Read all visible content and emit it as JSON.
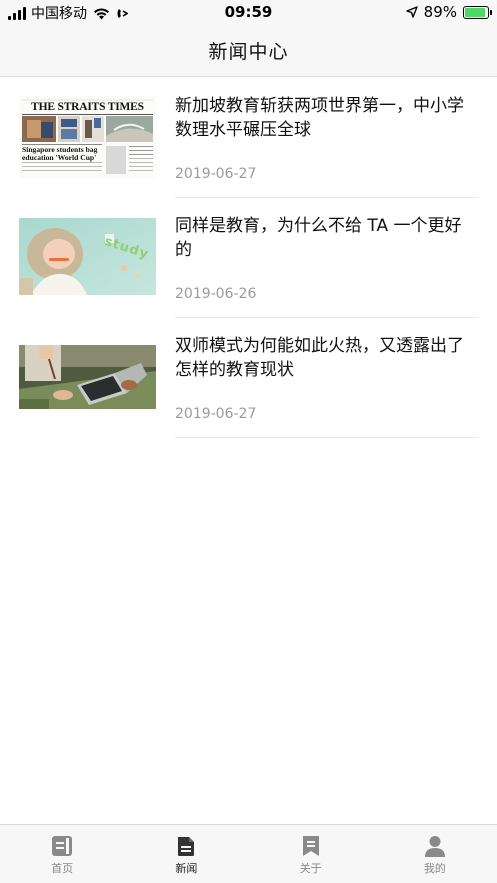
{
  "status_bar": {
    "carrier": "中国移动",
    "time": "09:59",
    "battery": "89%",
    "battery_level": 0.89
  },
  "header": {
    "title": "新闻中心"
  },
  "news": [
    {
      "title": "新加坡教育斩获两项世界第一，中小学数理水平碾压全球",
      "date": "2019-06-27",
      "thumb": {
        "masthead": "THE STRAITS TIMES",
        "headline": "Singapore students bag education 'World Cup'"
      }
    },
    {
      "title": "同样是教育，为什么不给 TA 一个更好的",
      "date": "2019-06-26",
      "thumb": {
        "word": "study"
      }
    },
    {
      "title": "双师模式为何能如此火热，又透露出了怎样的教育现状",
      "date": "2019-06-27",
      "thumb": {}
    }
  ],
  "tabs": [
    {
      "label": "首页",
      "icon": "book-icon",
      "active": false
    },
    {
      "label": "新闻",
      "icon": "document-icon",
      "active": true
    },
    {
      "label": "关于",
      "icon": "bookmark-icon",
      "active": false
    },
    {
      "label": "我的",
      "icon": "person-icon",
      "active": false
    }
  ]
}
